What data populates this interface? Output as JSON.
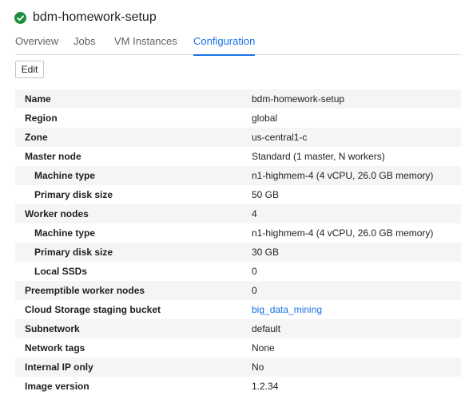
{
  "header": {
    "title": "bdm-homework-setup",
    "status_icon": "check-circle-icon",
    "status_color": "#1e8e3e"
  },
  "tabs": [
    {
      "label": "Overview",
      "active": false
    },
    {
      "label": "Jobs",
      "active": false
    },
    {
      "label": "VM Instances",
      "active": false
    },
    {
      "label": "Configuration",
      "active": true
    }
  ],
  "toolbar": {
    "edit_label": "Edit"
  },
  "details": [
    {
      "label": "Name",
      "value": "bdm-homework-setup"
    },
    {
      "label": "Region",
      "value": "global"
    },
    {
      "label": "Zone",
      "value": "us-central1-c"
    },
    {
      "label": "Master node",
      "value": "Standard (1 master, N workers)"
    },
    {
      "label": "Machine type",
      "value": "n1-highmem-4 (4 vCPU, 26.0 GB memory)",
      "indent": true
    },
    {
      "label": "Primary disk size",
      "value": "50 GB",
      "indent": true
    },
    {
      "label": "Worker nodes",
      "value": "4"
    },
    {
      "label": "Machine type",
      "value": "n1-highmem-4 (4 vCPU, 26.0 GB memory)",
      "indent": true
    },
    {
      "label": "Primary disk size",
      "value": "30 GB",
      "indent": true
    },
    {
      "label": "Local SSDs",
      "value": "0",
      "indent": true
    },
    {
      "label": "Preemptible worker nodes",
      "value": "0"
    },
    {
      "label": "Cloud Storage staging bucket",
      "value": "big_data_mining",
      "link": true
    },
    {
      "label": "Subnetwork",
      "value": "default"
    },
    {
      "label": "Network tags",
      "value": "None"
    },
    {
      "label": "Internal IP only",
      "value": "No"
    },
    {
      "label": "Image version",
      "value": "1.2.34"
    }
  ],
  "colors": {
    "accent": "#1a73e8",
    "row_alt": "#f5f5f5"
  }
}
